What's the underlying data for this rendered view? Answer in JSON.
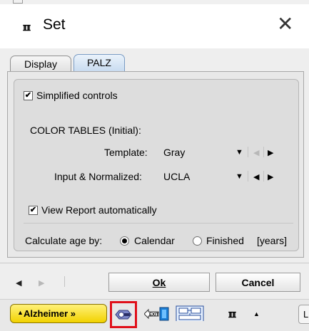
{
  "window": {
    "title": "Set",
    "app_icon": "PMOD-icon",
    "close_glyph": "✕"
  },
  "tabs": [
    {
      "label": "Display",
      "active": false
    },
    {
      "label": "PALZ",
      "active": true
    }
  ],
  "panel": {
    "simplified_controls": {
      "label": "Simplified controls",
      "checked": true
    },
    "color_tables_heading": "COLOR TABLES (Initial):",
    "template": {
      "label": "Template:",
      "value": "Gray"
    },
    "input_normalized": {
      "label": "Input & Normalized:",
      "value": "UCLA"
    },
    "view_report": {
      "label": "View Report automatically",
      "checked": true
    },
    "age": {
      "label": "Calculate age by:",
      "options": [
        "Calendar",
        "Finished"
      ],
      "selected": "Calendar",
      "unit": "[years]"
    }
  },
  "footer": {
    "ok_label": "Ok",
    "cancel_label": "Cancel"
  },
  "taskbar": {
    "alzheimer_label": "Alzheimer »",
    "l_label": "L"
  },
  "colors": {
    "alzheimer_button": "#f2d200",
    "highlight_border": "#e0101a",
    "active_tab": "#c9dcf0"
  }
}
